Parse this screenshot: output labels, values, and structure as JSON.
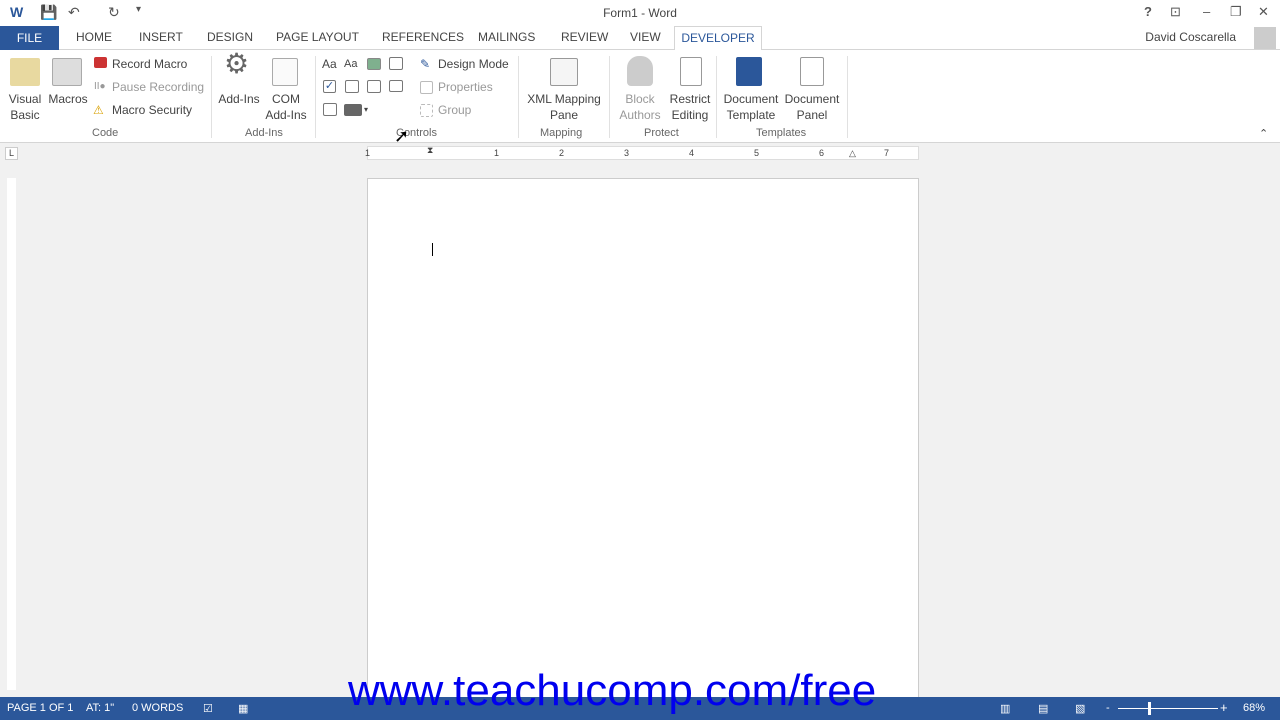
{
  "titlebar": {
    "title": "Form1 - Word",
    "help": "?",
    "minimize": "–",
    "restore": "❐",
    "close": "✕",
    "ribbon_display": "⊡"
  },
  "tabs": {
    "file": "FILE",
    "items": [
      "HOME",
      "INSERT",
      "DESIGN",
      "PAGE LAYOUT",
      "REFERENCES",
      "MAILINGS",
      "REVIEW",
      "VIEW"
    ],
    "active": "DEVELOPER",
    "user": "David Coscarella"
  },
  "ribbon": {
    "code": {
      "visual_basic": [
        "Visual",
        "Basic"
      ],
      "macros": "Macros",
      "record_macro": "Record Macro",
      "pause_recording": "Pause Recording",
      "macro_security": "Macro Security",
      "label": "Code"
    },
    "addins": {
      "addins": "Add-Ins",
      "com": [
        "COM",
        "Add-Ins"
      ],
      "label": "Add-Ins"
    },
    "controls": {
      "design_mode": "Design Mode",
      "properties": "Properties",
      "group": "Group",
      "aa1": "Aa",
      "aa2": "Aa",
      "label": "Controls"
    },
    "mapping": {
      "xml": [
        "XML Mapping",
        "Pane"
      ],
      "label": "Mapping"
    },
    "protect": {
      "block": [
        "Block",
        "Authors"
      ],
      "restrict": [
        "Restrict",
        "Editing"
      ],
      "label": "Protect"
    },
    "templates": {
      "doc_template": [
        "Document",
        "Template"
      ],
      "doc_panel": [
        "Document",
        "Panel"
      ],
      "label": "Templates"
    }
  },
  "ruler": {
    "numbers": [
      "1",
      "1",
      "2",
      "3",
      "4",
      "5",
      "6",
      "7"
    ]
  },
  "status": {
    "page": "PAGE 1 OF 1",
    "at": "AT: 1\"",
    "words": "0 WORDS",
    "zoom": "68%",
    "zoom_percent": 68
  },
  "watermark": "www.teachucomp.com/free",
  "colors": {
    "accent": "#2b579a",
    "watermark": "#0000ee"
  }
}
